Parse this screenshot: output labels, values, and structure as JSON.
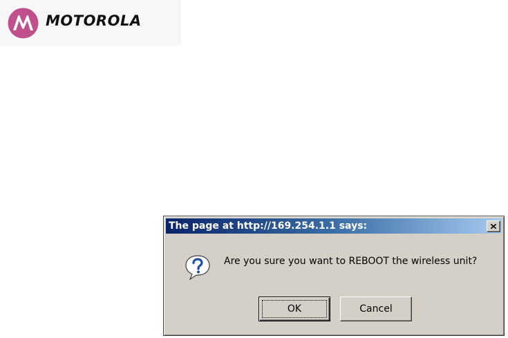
{
  "header": {
    "logo_text": "MOTOROLA",
    "logo_icon": "motorola-batwing-icon",
    "brand_color": "#c0508c"
  },
  "dialog": {
    "title": "The page at http://169.254.1.1 says:",
    "message": "Are you sure you want to REBOOT the wireless unit?",
    "icon": "question-icon",
    "close_icon": "close-icon",
    "ok_label": "OK",
    "cancel_label": "Cancel",
    "title_color_start": "#0a246a",
    "title_color_end": "#a6caf0",
    "face_color": "#d4d0c8"
  }
}
